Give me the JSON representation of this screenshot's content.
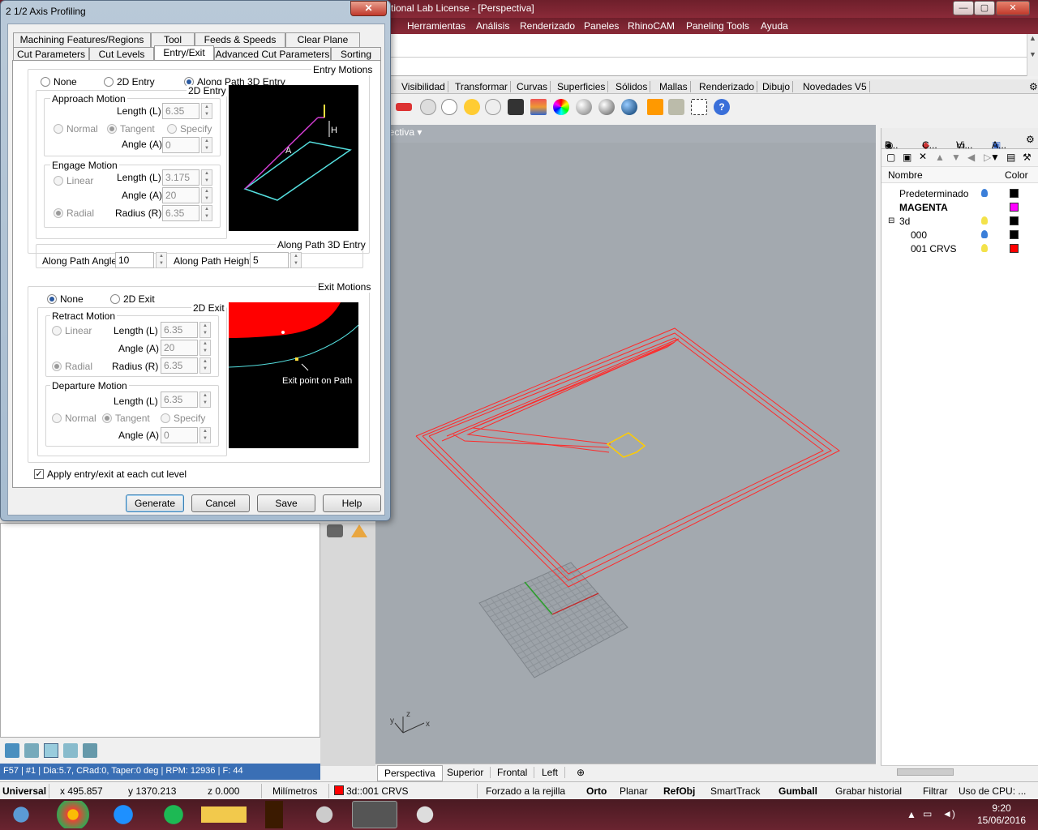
{
  "rhino": {
    "title": "tional Lab License - [Perspectiva]",
    "menu": [
      "Herramientas",
      "Análisis",
      "Renderizado",
      "Paneles",
      "RhinoCAM",
      "Paneling Tools",
      "Ayuda"
    ],
    "tabs": [
      "Visibilidad",
      "Transformar",
      "Curvas",
      "Superficies",
      "Sólidos",
      "Mallas",
      "Renderizado",
      "Dibujo",
      "Novedades V5"
    ],
    "viewport_label": "rspectiva",
    "viewport_tabs": [
      "Perspectiva",
      "Superior",
      "Frontal",
      "Left"
    ],
    "status_line": "F57 | #1 | Dia:5.7, CRad:0, Taper:0 deg | RPM: 12936 | F: 44",
    "axis": {
      "x": "x",
      "y": "y",
      "z": "z"
    },
    "window_buttons": {
      "minimize": "—",
      "restore": "▢",
      "close": "✕"
    }
  },
  "layers": {
    "tabs": [
      "P...",
      "C...",
      "Vi...",
      "A..."
    ],
    "header": {
      "name": "Nombre",
      "color": "Color"
    },
    "items": [
      {
        "name": "Predeterminado",
        "color": "#000000",
        "bulb": "#3b7fd9"
      },
      {
        "name": "MAGENTA",
        "color": "#ff00ff",
        "bulb": null,
        "bold": true
      },
      {
        "name": "3d",
        "color": "#000000",
        "bulb": "#f3e24a",
        "expander": "⊟"
      },
      {
        "name": "000",
        "color": "#000000",
        "bulb": "#3b7fd9"
      },
      {
        "name": "001 CRVS",
        "color": "#ff0000",
        "bulb": "#f3e24a"
      }
    ]
  },
  "statusbar": {
    "unit_mode": "Universal",
    "x": "x 495.857",
    "y": "y 1370.213",
    "z": "z 0.000",
    "units": "Milímetros",
    "layer": "3d::001 CRVS",
    "layer_color": "#ff0000",
    "snap": "Forzado a la rejilla",
    "ortho": "Orto",
    "planar": "Planar",
    "osnap": "RefObj",
    "smarttrack": "SmartTrack",
    "gumball": "Gumball",
    "history": "Grabar historial",
    "filter": "Filtrar",
    "cpu": "Uso de CPU: ..."
  },
  "taskbar": {
    "time": "9:20",
    "date": "15/06/2016"
  },
  "dialog": {
    "title": "2 1/2 Axis Profiling",
    "close_label": "✕",
    "tabs_row1": [
      "Machining Features/Regions",
      "Tool",
      "Feeds & Speeds",
      "Clear Plane"
    ],
    "tabs_row2": [
      "Cut Parameters",
      "Cut Levels",
      "Entry/Exit",
      "Advanced Cut Parameters",
      "Sorting"
    ],
    "entry": {
      "group": "Entry Motions",
      "options": [
        "None",
        "2D Entry",
        "Along Path 3D Entry"
      ],
      "selected": "Along Path 3D Entry",
      "sub_group": "2D Entry",
      "approach": {
        "label": "Approach Motion",
        "length_label": "Length (L)",
        "length": "6.35",
        "dir_options": [
          "Normal",
          "Tangent",
          "Specify"
        ],
        "angle_label": "Angle (A)",
        "angle": "0"
      },
      "engage": {
        "label": "Engage Motion",
        "options": [
          "Linear",
          "Radial"
        ],
        "length_label": "Length (L)",
        "length": "3.175",
        "angle_label": "Angle (A)",
        "angle": "20",
        "radius_label": "Radius (R)",
        "radius": "6.35"
      },
      "along": {
        "group": "Along Path 3D Entry",
        "angle_label": "Along Path Angle",
        "angle": "10",
        "height_label": "Along Path Height",
        "height": "5"
      },
      "pic_labels": {
        "h": "H",
        "a": "A"
      }
    },
    "exit": {
      "group": "Exit Motions",
      "options": [
        "None",
        "2D Exit"
      ],
      "selected": "None",
      "sub_group": "2D Exit",
      "retract": {
        "label": "Retract Motion",
        "options": [
          "Linear",
          "Radial"
        ],
        "length_label": "Length (L)",
        "length": "6.35",
        "angle_label": "Angle (A)",
        "angle": "20",
        "radius_label": "Radius (R)",
        "radius": "6.35"
      },
      "departure": {
        "label": "Departure Motion",
        "length_label": "Length (L)",
        "length": "6.35",
        "dir_options": [
          "Normal",
          "Tangent",
          "Specify"
        ],
        "angle_label": "Angle (A)",
        "angle": "0"
      },
      "pic_label": "Exit point on Path"
    },
    "apply_label": "Apply entry/exit at each cut level",
    "buttons": {
      "generate": "Generate",
      "cancel": "Cancel",
      "save": "Save",
      "help": "Help"
    }
  },
  "colors": {
    "toolpath": "#ff2a2a",
    "feature": "#ffcc00",
    "dialog_accent": "#2a59a0"
  }
}
